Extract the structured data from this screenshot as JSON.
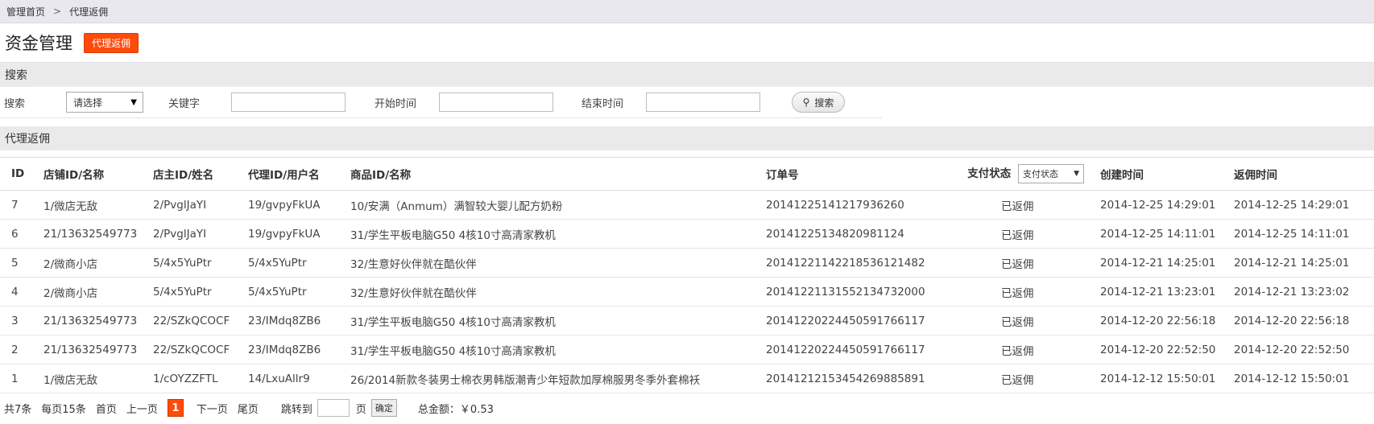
{
  "breadcrumb": {
    "home": "管理首页",
    "separator": ">",
    "current": "代理返佣"
  },
  "header": {
    "title": "资金管理",
    "badge": "代理返佣"
  },
  "search": {
    "section_title": "搜索",
    "type_label": "搜索",
    "type_value": "请选择",
    "keyword_label": "关键字",
    "keyword_value": "",
    "start_label": "开始时间",
    "start_value": "",
    "end_label": "结束时间",
    "end_value": "",
    "button_label": "搜索"
  },
  "list": {
    "section_title": "代理返佣",
    "columns": {
      "id": "ID",
      "shop": "店铺ID/名称",
      "owner": "店主ID/姓名",
      "agent": "代理ID/用户名",
      "product": "商品ID/名称",
      "order": "订单号",
      "pay_status": "支付状态",
      "pay_status_filter": "支付状态",
      "created": "创建时间",
      "rebate": "返佣时间"
    },
    "rows": [
      {
        "id": "7",
        "shop": "1/微店无敌",
        "owner": "2/PvglJaYI",
        "agent": "19/gvpyFkUA",
        "product": "10/安满（Anmum）满智较大婴儿配方奶粉",
        "order": "20141225141217936260",
        "status": "已返佣",
        "created": "2014-12-25 14:29:01",
        "rebate": "2014-12-25 14:29:01"
      },
      {
        "id": "6",
        "shop": "21/13632549773",
        "owner": "2/PvglJaYI",
        "agent": "19/gvpyFkUA",
        "product": "31/学生平板电脑G50 4核10寸高清家教机",
        "order": "20141225134820981124",
        "status": "已返佣",
        "created": "2014-12-25 14:11:01",
        "rebate": "2014-12-25 14:11:01"
      },
      {
        "id": "5",
        "shop": "2/微商小店",
        "owner": "5/4x5YuPtr",
        "agent": "5/4x5YuPtr",
        "product": "32/生意好伙伴就在酷伙伴",
        "order": "20141221142218536121482",
        "status": "已返佣",
        "created": "2014-12-21 14:25:01",
        "rebate": "2014-12-21 14:25:01"
      },
      {
        "id": "4",
        "shop": "2/微商小店",
        "owner": "5/4x5YuPtr",
        "agent": "5/4x5YuPtr",
        "product": "32/生意好伙伴就在酷伙伴",
        "order": "20141221131552134732000",
        "status": "已返佣",
        "created": "2014-12-21 13:23:01",
        "rebate": "2014-12-21 13:23:02"
      },
      {
        "id": "3",
        "shop": "21/13632549773",
        "owner": "22/SZkQCOCF",
        "agent": "23/IMdq8ZB6",
        "product": "31/学生平板电脑G50 4核10寸高清家教机",
        "order": "20141220224450591766117",
        "status": "已返佣",
        "created": "2014-12-20 22:56:18",
        "rebate": "2014-12-20 22:56:18"
      },
      {
        "id": "2",
        "shop": "21/13632549773",
        "owner": "22/SZkQCOCF",
        "agent": "23/IMdq8ZB6",
        "product": "31/学生平板电脑G50 4核10寸高清家教机",
        "order": "20141220224450591766117",
        "status": "已返佣",
        "created": "2014-12-20 22:52:50",
        "rebate": "2014-12-20 22:52:50"
      },
      {
        "id": "1",
        "shop": "1/微店无敌",
        "owner": "1/cOYZZFTL",
        "agent": "14/LxuAllr9",
        "product": "26/2014新款冬装男士棉衣男韩版潮青少年短款加厚棉服男冬季外套棉袄",
        "order": "20141212153454269885891",
        "status": "已返佣",
        "created": "2014-12-12 15:50:01",
        "rebate": "2014-12-12 15:50:01"
      }
    ]
  },
  "pager": {
    "total": "共7条",
    "per_page": "每页15条",
    "first": "首页",
    "prev": "上一页",
    "current": "1",
    "next": "下一页",
    "last": "尾页",
    "jump_label": "跳转到",
    "page_unit": "页",
    "confirm": "确定",
    "sum": "总金额：￥0.53"
  },
  "colors": {
    "accent": "#ff4b0a",
    "topbar": "#e8e8ee",
    "section": "#eaeaea"
  },
  "icons": {
    "search_button": "search-icon",
    "select": "chevron-down-icon"
  }
}
